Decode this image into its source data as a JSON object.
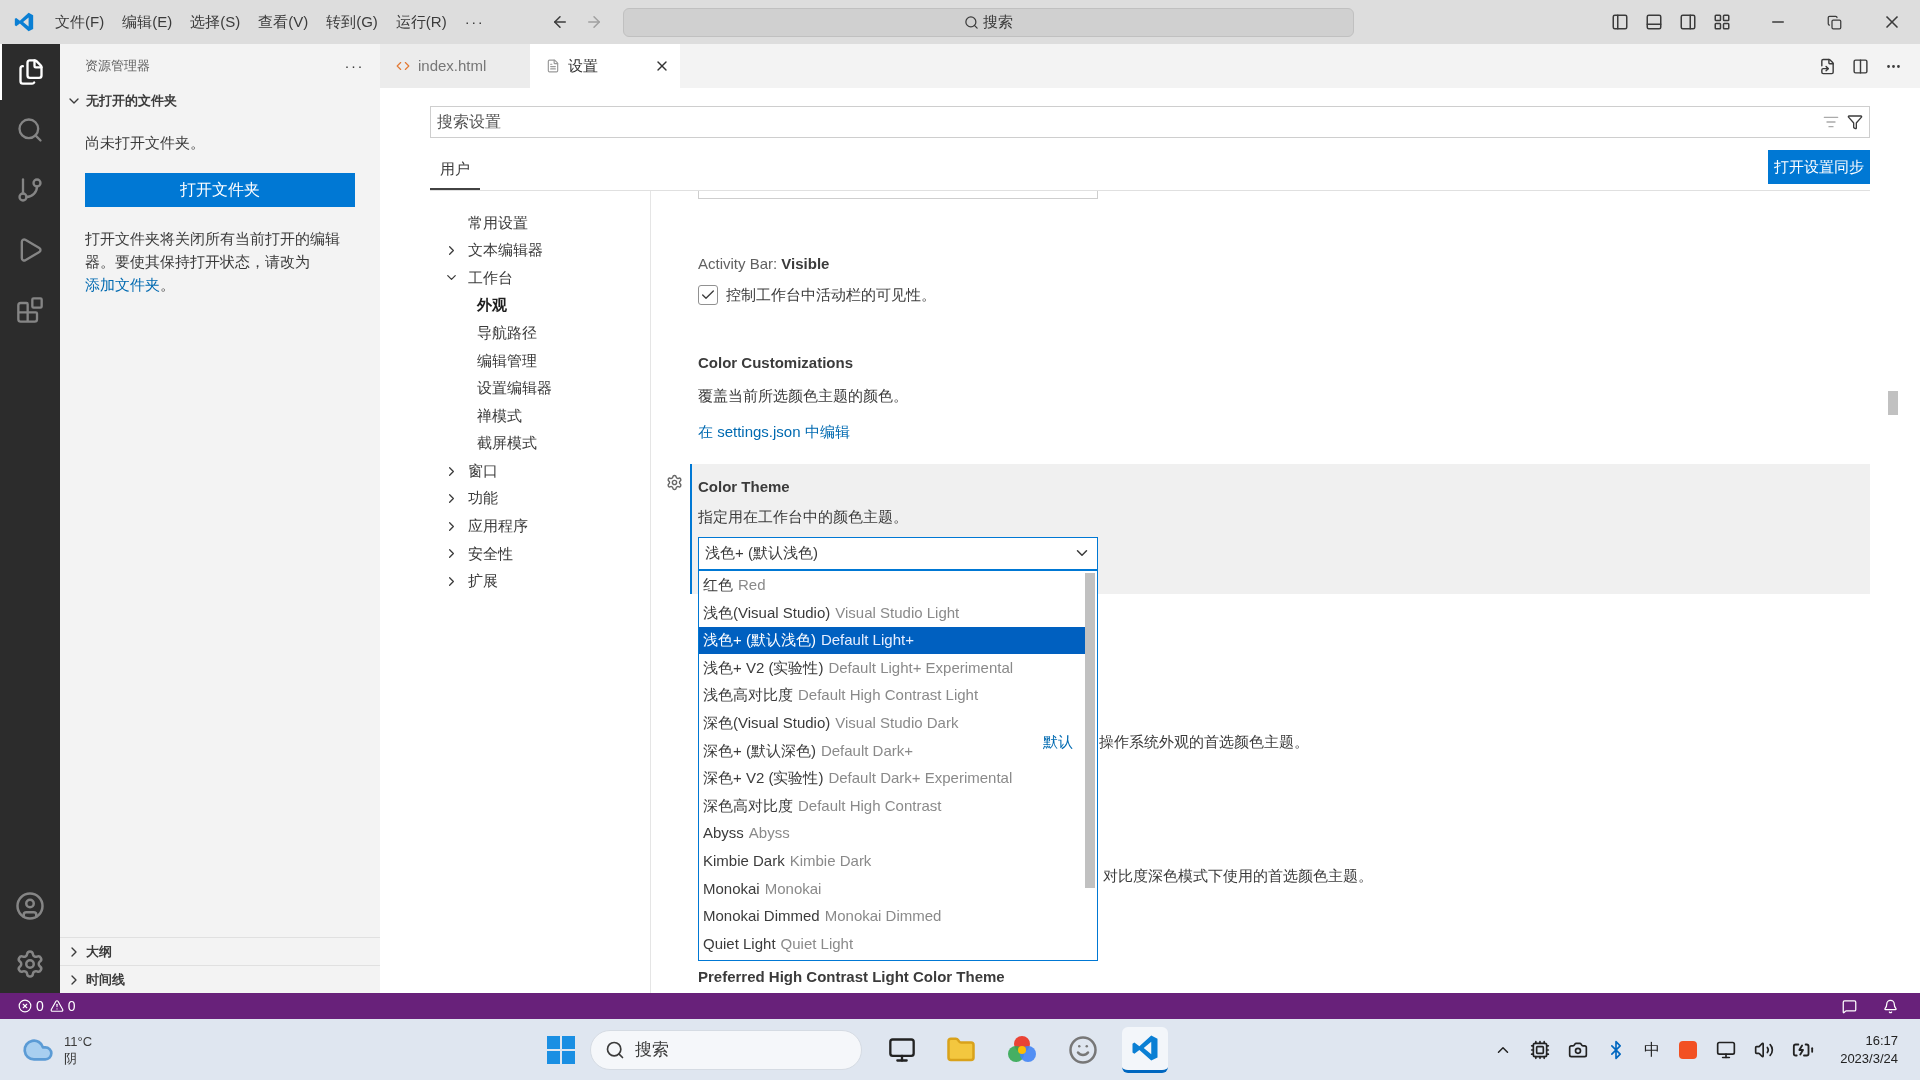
{
  "title_bar": {
    "menus": [
      "文件(F)",
      "编辑(E)",
      "选择(S)",
      "查看(V)",
      "转到(G)",
      "运行(R)"
    ],
    "more": "···",
    "search": "搜索"
  },
  "sidebar": {
    "title": "资源管理器",
    "more": "···",
    "section": {
      "label": "无打开的文件夹",
      "expanded": true
    },
    "message": "尚未打开文件夹。",
    "open_button": "打开文件夹",
    "note": "打开文件夹将关闭所有当前打开的编辑器。要使其保持打开状态，请改为",
    "note_link": "添加文件夹",
    "note_end": "。",
    "bottom_sections": [
      {
        "label": "大纲",
        "expanded": false
      },
      {
        "label": "时间线",
        "expanded": false
      }
    ]
  },
  "tabs": [
    {
      "label": "index.html",
      "kind": "html",
      "selected": false
    },
    {
      "label": "设置",
      "kind": "settings",
      "selected": true
    }
  ],
  "settings": {
    "search_placeholder": "搜索设置",
    "scope_tabs": [
      {
        "label": "用户",
        "selected": true
      }
    ],
    "sync_button": "打开设置同步",
    "toc": [
      {
        "label": "常用设置",
        "kind": "leaf",
        "selected": false
      },
      {
        "label": "文本编辑器",
        "kind": "group",
        "expanded": false
      },
      {
        "label": "工作台",
        "kind": "group",
        "expanded": true,
        "children": [
          {
            "label": "外观",
            "selected": true
          },
          {
            "label": "导航路径",
            "selected": false
          },
          {
            "label": "编辑管理",
            "selected": false
          },
          {
            "label": "设置编辑器",
            "selected": false
          },
          {
            "label": "禅模式",
            "selected": false
          },
          {
            "label": "截屏模式",
            "selected": false
          }
        ]
      },
      {
        "label": "窗口",
        "kind": "group",
        "expanded": false
      },
      {
        "label": "功能",
        "kind": "group",
        "expanded": false
      },
      {
        "label": "应用程序",
        "kind": "group",
        "expanded": false
      },
      {
        "label": "安全性",
        "kind": "group",
        "expanded": false
      },
      {
        "label": "扩展",
        "kind": "group",
        "expanded": false
      }
    ],
    "activity_bar": {
      "category": "Activity Bar: ",
      "name": "Visible",
      "checked": true,
      "description": "控制工作台中活动栏的可见性。"
    },
    "color_customizations": {
      "name": "Color Customizations",
      "description": "覆盖当前所选颜色主题的颜色。",
      "link": "在 settings.json 中编辑"
    },
    "color_theme": {
      "name": "Color Theme",
      "description": "指定用在工作台中的颜色主题。",
      "value": "浅色+ (默认浅色)",
      "expanded": true,
      "options": [
        {
          "label": "红色",
          "detail": "Red",
          "selected": false
        },
        {
          "label": "浅色(Visual Studio)",
          "detail": "Visual Studio Light",
          "selected": false
        },
        {
          "label": "浅色+ (默认浅色)",
          "detail": "Default Light+",
          "selected": true
        },
        {
          "label": "浅色+ V2 (实验性)",
          "detail": "Default Light+ Experimental",
          "selected": false
        },
        {
          "label": "浅色高对比度",
          "detail": "Default High Contrast Light",
          "selected": false
        },
        {
          "label": "深色(Visual Studio)",
          "detail": "Visual Studio Dark",
          "selected": false
        },
        {
          "label": "深色+ (默认深色)",
          "detail": "Default Dark+",
          "selected": false
        },
        {
          "label": "深色+ V2 (实验性)",
          "detail": "Default Dark+ Experimental",
          "selected": false
        },
        {
          "label": "深色高对比度",
          "detail": "Default High Contrast",
          "selected": false
        },
        {
          "label": "Abyss",
          "detail": "Abyss",
          "selected": false
        },
        {
          "label": "Kimbie Dark",
          "detail": "Kimbie Dark",
          "selected": false
        },
        {
          "label": "Monokai",
          "detail": "Monokai",
          "selected": false
        },
        {
          "label": "Monokai Dimmed",
          "detail": "Monokai Dimmed",
          "selected": false
        },
        {
          "label": "Quiet Light",
          "detail": "Quiet Light",
          "selected": false
        }
      ]
    },
    "partly_covered": [
      {
        "link": "默认",
        "description": "操作系统外观的首选颜色主题。"
      },
      {
        "description": "对比度深色模式下使用的首选颜色主题。"
      }
    ],
    "next_setting": "Preferred High Contrast Light Color Theme"
  },
  "status_bar": {
    "errors": "0",
    "warnings": "0"
  },
  "taskbar": {
    "temperature": "11°C",
    "weather": "阴",
    "search": "搜索",
    "time": "16:17",
    "date": "2023/3/24",
    "ime": "中"
  }
}
